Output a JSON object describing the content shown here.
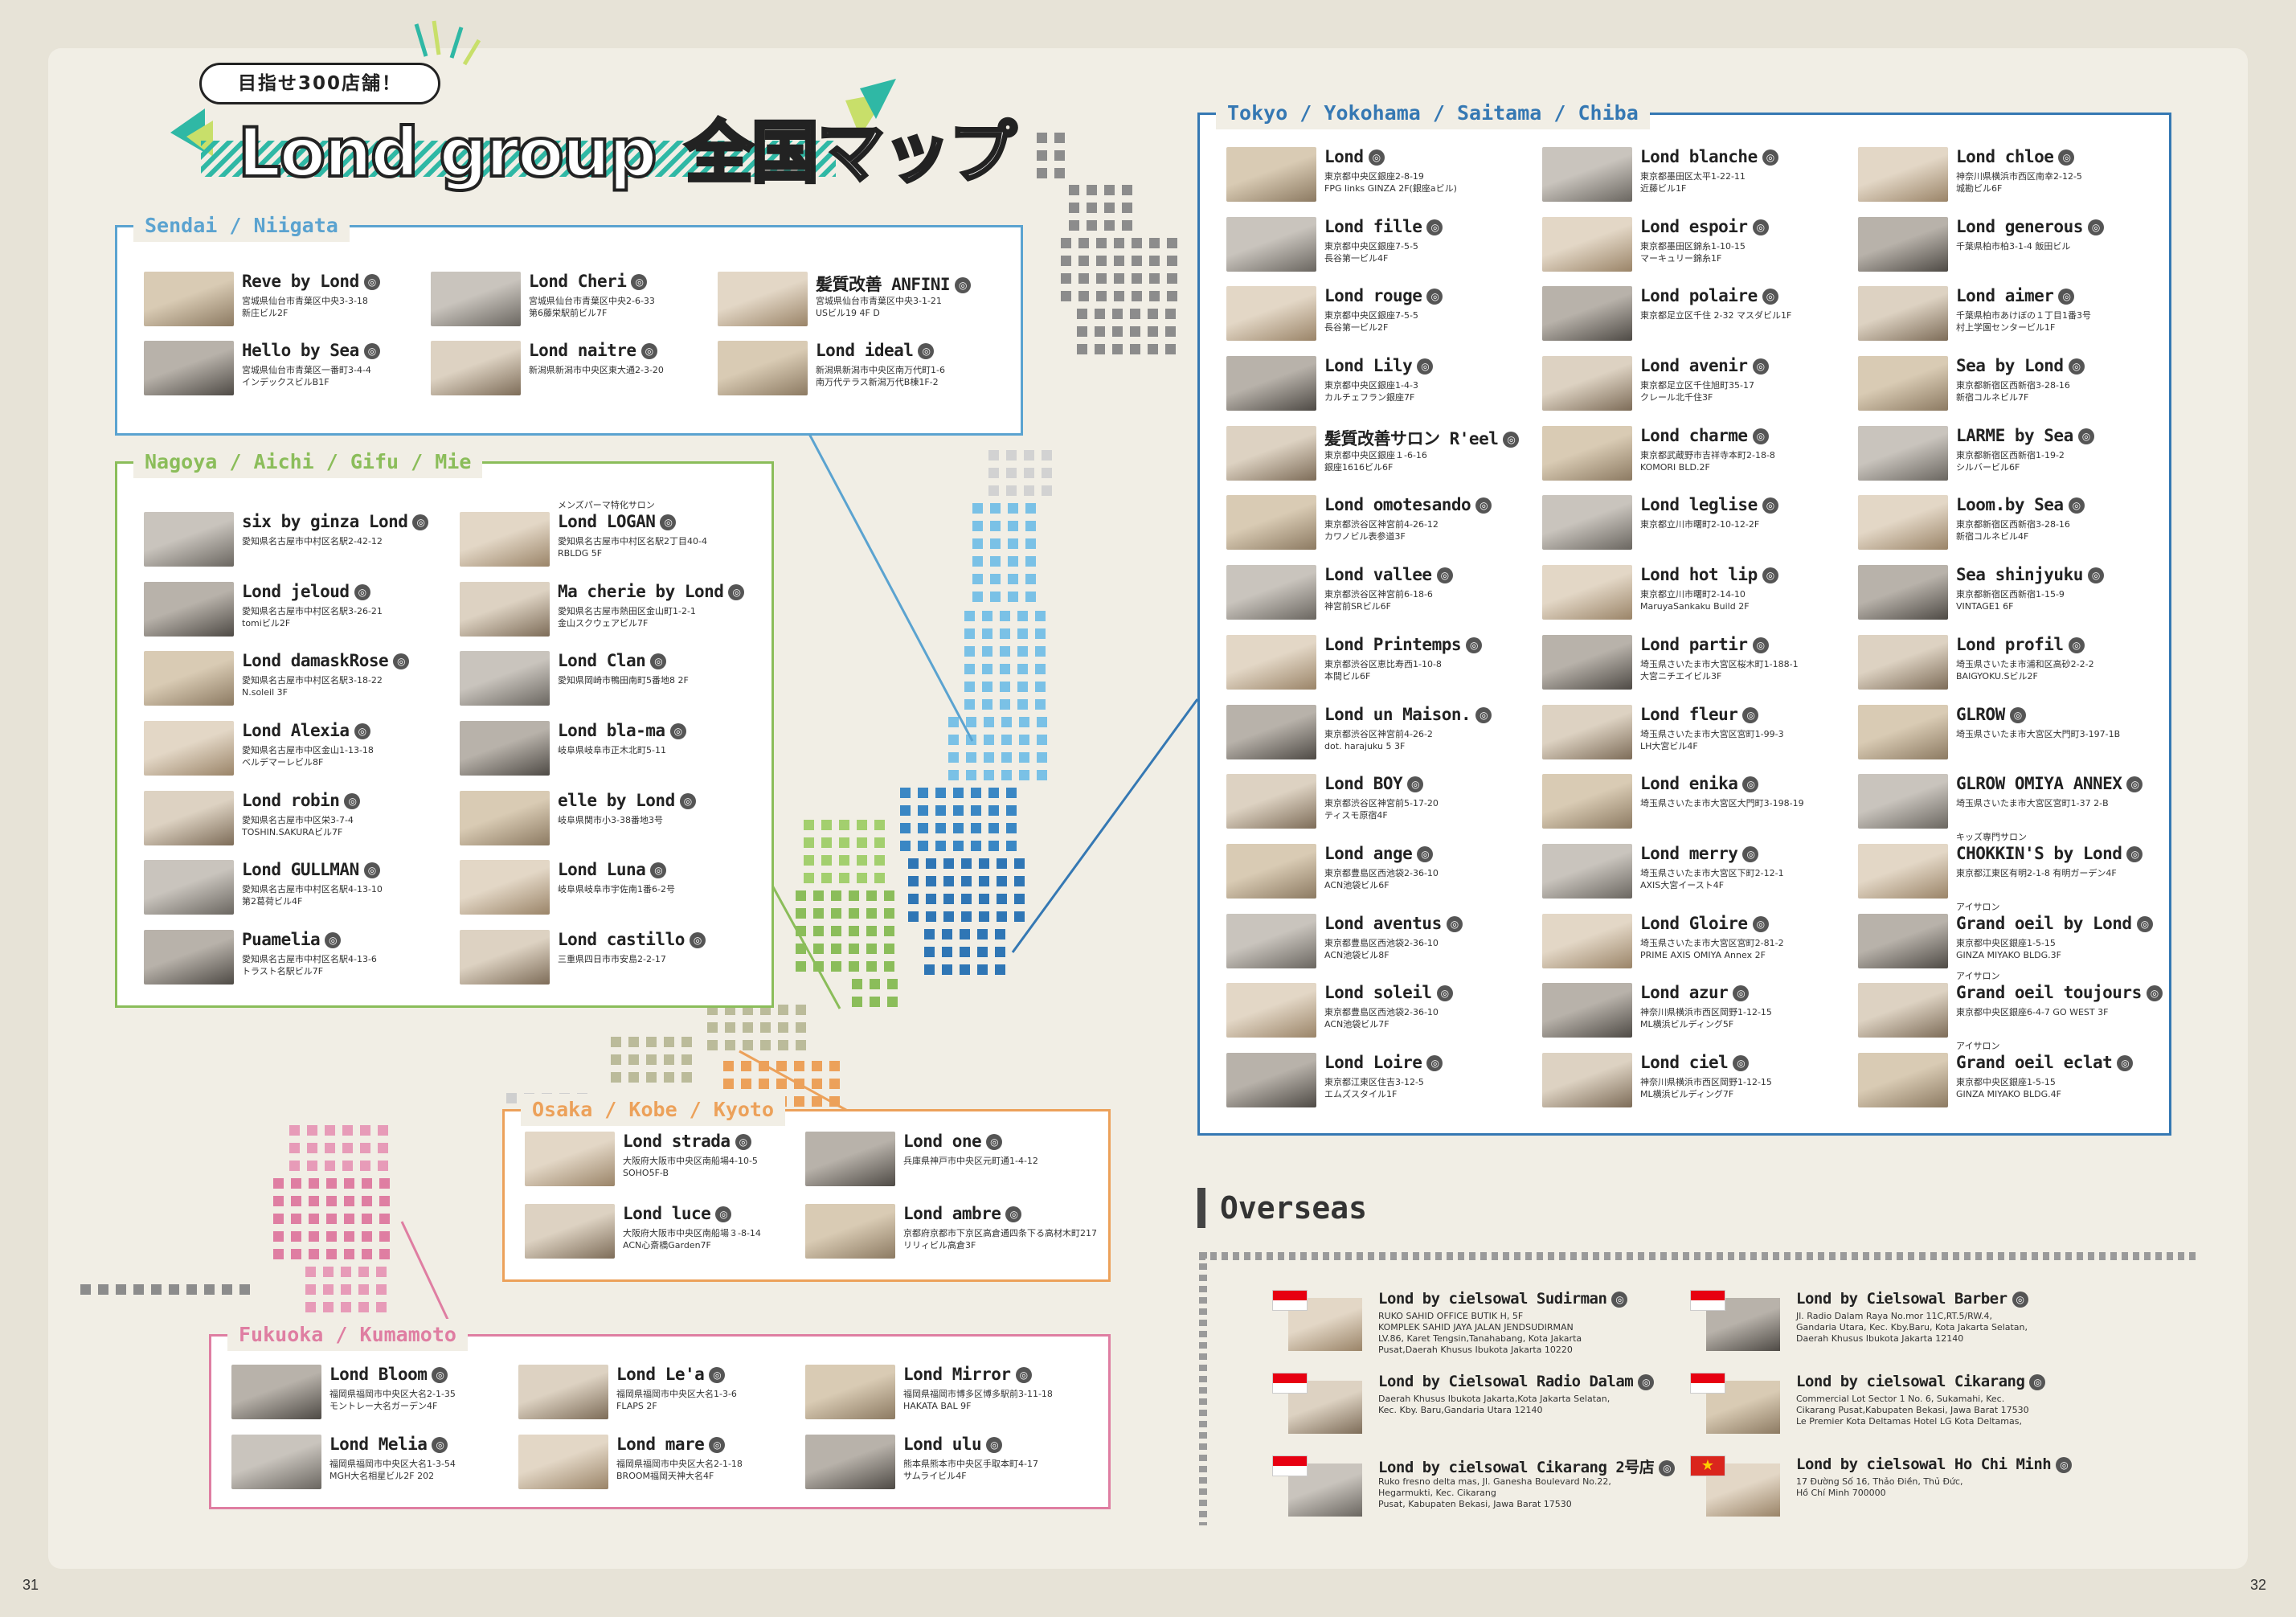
{
  "header": {
    "badge": "目指せ300店舗！",
    "title_latin": "Lond group",
    "title_jp": "全国マップ"
  },
  "pages": {
    "left": "31",
    "right": "32"
  },
  "colors": {
    "sendai": "#5ba3d0",
    "nagoya": "#8bbd5a",
    "osaka": "#eca15a",
    "fukuoka": "#df7ea2",
    "tokyo": "#3578b3",
    "accent_teal": "#2fb8a5",
    "accent_lime": "#c8df6a"
  },
  "regions": [
    {
      "title": "Sendai / Niigata",
      "stores": [
        {
          "name": "Reve by Lond",
          "address": "宮城県仙台市青葉区中央3-3-18\n新庄ビル2F"
        },
        {
          "name": "Lond Cheri",
          "address": "宮城県仙台市青葉区中央2-6-33\n第6藤栄駅前ビル7F"
        },
        {
          "name": "髪質改善 ANFINI",
          "address": "宮城県仙台市青葉区中央3-1-21\nUSビル19 4F D"
        },
        {
          "name": "Hello by Sea",
          "address": "宮城県仙台市青葉区一番町3-4-4\nインデックスビルB1F"
        },
        {
          "name": "Lond naitre",
          "address": "新潟県新潟市中央区東大通2-3-20"
        },
        {
          "name": "Lond ideal",
          "address": "新潟県新潟市中央区南万代町1-6\n南万代テラス新潟万代B棟1F-2"
        }
      ]
    },
    {
      "title": "Nagoya / Aichi / Gifu / Mie",
      "stores": [
        {
          "name": "six by ginza Lond",
          "address": "愛知県名古屋市中村区名駅2-42-12"
        },
        {
          "tag": "メンズパーマ特化サロン",
          "name": "Lond LOGAN",
          "address": "愛知県名古屋市中村区名駅2丁目40-4\nRBLDG 5F"
        },
        {
          "name": "Lond jeloud",
          "address": "愛知県名古屋市中村区名駅3-26-21\ntomiビル2F"
        },
        {
          "name": "Ma cherie by Lond",
          "address": "愛知県名古屋市熱田区金山町1-2-1\n金山スクウェアビル7F"
        },
        {
          "name": "Lond damaskRose",
          "address": "愛知県名古屋市中村区名駅3-18-22\nN.soleil 3F"
        },
        {
          "name": "Lond Clan",
          "address": "愛知県岡崎市鴨田南町5番地8 2F"
        },
        {
          "name": "Lond Alexia",
          "address": "愛知県名古屋市中区金山1-13-18\nベルデマーレビル8F"
        },
        {
          "name": "Lond bla-ma",
          "address": "岐阜県岐阜市正木北町5-11"
        },
        {
          "name": "Lond robin",
          "address": "愛知県名古屋市中区栄3-7-4\nTOSHIN.SAKURAビル7F"
        },
        {
          "name": "elle by Lond",
          "address": "岐阜県関市小3-38番地3号"
        },
        {
          "name": "Lond GULLMAN",
          "address": "愛知県名古屋市中村区名駅4-13-10\n第2葛荷ビル4F"
        },
        {
          "name": "Lond Luna",
          "address": "岐阜県岐阜市宇佐南1番6-2号"
        },
        {
          "name": "Puamelia",
          "address": "愛知県名古屋市中村区名駅4-13-6\nトラスト名駅ビル7F"
        },
        {
          "name": "Lond castillo",
          "address": "三重県四日市市安島2-2-17"
        }
      ]
    },
    {
      "title": "Osaka / Kobe / Kyoto",
      "stores": [
        {
          "name": "Lond strada",
          "address": "大阪府大阪市中央区南船場4-10-5\nSOHO5F-B"
        },
        {
          "name": "Lond one",
          "address": "兵庫県神戸市中央区元町通1-4-12"
        },
        {
          "name": "Lond luce",
          "address": "大阪府大阪市中央区南船場３-8-14\nACN心斎橋Garden7F"
        },
        {
          "name": "Lond ambre",
          "address": "京都府京都市下京区高倉通四条下る高材木町217\nリリィビル高倉3F"
        }
      ]
    },
    {
      "title": "Fukuoka / Kumamoto",
      "stores": [
        {
          "name": "Lond Bloom",
          "address": "福岡県福岡市中央区大名2-1-35\nモントレー大名ガーデン4F"
        },
        {
          "name": "Lond Le'a",
          "address": "福岡県福岡市中央区大名1-3-6\nFLAPS 2F"
        },
        {
          "name": "Lond Mirror",
          "address": "福岡県福岡市博多区博多駅前3-11-18\nHAKATA BAL 9F"
        },
        {
          "name": "Lond Melia",
          "address": "福岡県福岡市中央区大名1-3-54\nMGH大名相星ビル2F 202"
        },
        {
          "name": "Lond mare",
          "address": "福岡県福岡市中央区大名2-1-18\nBROOM福岡天神大名4F"
        },
        {
          "name": "Lond ulu",
          "address": "熊本県熊本市中央区手取本町4-17\nサムライビル4F"
        }
      ]
    },
    {
      "title": "Tokyo / Yokohama / Saitama / Chiba",
      "columns": [
        [
          {
            "name": "Lond",
            "address": "東京都中央区銀座2-8-19\nFPG links GINZA 2F(銀座aビル)"
          },
          {
            "name": "Lond fille",
            "address": "東京都中央区銀座7-5-5\n長谷第一ビル4F"
          },
          {
            "name": "Lond rouge",
            "address": "東京都中央区銀座7-5-5\n長谷第一ビル2F"
          },
          {
            "name": "Lond Lily",
            "address": "東京都中央区銀座1-4-3\nカルチェフラン銀座7F"
          },
          {
            "name": "髪質改善サロン R'eel",
            "address": "東京都中央区銀座１-6-16\n銀座1616ビル6F"
          },
          {
            "name": "Lond omotesando",
            "address": "東京都渋谷区神宮前4-26-12\nカワノビル表参道3F"
          },
          {
            "name": "Lond vallee",
            "address": "東京都渋谷区神宮前6-18-6\n神宮前SRビル6F"
          },
          {
            "name": "Lond Printemps",
            "address": "東京都渋谷区恵比寿西1-10-8\n本間ビル6F"
          },
          {
            "name": "Lond un Maison.",
            "address": "東京都渋谷区神宮前4-26-2\ndot. harajuku 5 3F"
          },
          {
            "name": "Lond BOY",
            "address": "東京都渋谷区神宮前5-17-20\nティスモ原宿4F"
          },
          {
            "name": "Lond ange",
            "address": "東京都豊島区西池袋2-36-10\nACN池袋ビル6F"
          },
          {
            "name": "Lond aventus",
            "address": "東京都豊島区西池袋2-36-10\nACN池袋ビル8F"
          },
          {
            "name": "Lond soleil",
            "address": "東京都豊島区西池袋2-36-10\nACN池袋ビル7F"
          },
          {
            "name": "Lond Loire",
            "address": "東京都江東区住吉3-12-5\nエムズスタイル1F"
          }
        ],
        [
          {
            "name": "Lond blanche",
            "address": "東京都墨田区太平1-22-11\n近藤ビル1F"
          },
          {
            "name": "Lond espoir",
            "address": "東京都墨田区錦糸1-10-15\nマーキュリー錦糸1F"
          },
          {
            "name": "Lond polaire",
            "address": "東京都足立区千住 2-32 マスダビル1F"
          },
          {
            "name": "Lond avenir",
            "address": "東京都足立区千住旭町35-17\nクレール北千住3F"
          },
          {
            "name": "Lond charme",
            "address": "東京都武蔵野市吉祥寺本町2-18-8\nKOMORI BLD.2F"
          },
          {
            "name": "Lond leglise",
            "address": "東京都立川市曙町2-10-12-2F"
          },
          {
            "name": "Lond hot lip",
            "address": "東京都立川市曙町2-14-10\nMaruyaSankaku Build 2F"
          },
          {
            "name": "Lond partir",
            "address": "埼玉県さいたま市大宮区桜木町1-188-1\n大宮ニチエイビル3F"
          },
          {
            "name": "Lond fleur",
            "address": "埼玉県さいたま市大宮区宮町1-99-3\nLH大宮ビル4F"
          },
          {
            "name": "Lond enika",
            "address": "埼玉県さいたま市大宮区大門町3-198-19"
          },
          {
            "name": "Lond merry",
            "address": "埼玉県さいたま市大宮区下町2-12-1\nAXIS大宮イースト4F"
          },
          {
            "name": "Lond Gloire",
            "address": "埼玉県さいたま市大宮区宮町2-81-2\nPRIME AXIS OMIYA Annex 2F"
          },
          {
            "name": "Lond azur",
            "address": "神奈川県横浜市西区岡野1-12-15\nML横浜ビルディング5F"
          },
          {
            "name": "Lond ciel",
            "address": "神奈川県横浜市西区岡野1-12-15\nML横浜ビルディング7F"
          }
        ],
        [
          {
            "name": "Lond chloe",
            "address": "神奈川県横浜市西区南幸2-12-5\n城勘ビル6F"
          },
          {
            "name": "Lond generous",
            "address": "千葉県柏市柏3-1-4 飯田ビル"
          },
          {
            "name": "Lond aimer",
            "address": "千葉県柏市あけぼの１丁目1番3号\n村上学園センタービル1F"
          },
          {
            "name": "Sea by Lond",
            "address": "東京都新宿区西新宿3-28-16\n新宿コルネビル7F"
          },
          {
            "name": "LARME by Sea",
            "address": "東京都新宿区西新宿1-19-2\nシルバービル6F"
          },
          {
            "name": "Loom.by Sea",
            "address": "東京都新宿区西新宿3-28-16\n新宿コルネビル4F"
          },
          {
            "name": "Sea shinjyuku",
            "address": "東京都新宿区西新宿1-15-9\nVINTAGE1 6F"
          },
          {
            "name": "Lond profil",
            "address": "埼玉県さいたま市浦和区高砂2-2-2\nBAIGYOKU.Sビル2F"
          },
          {
            "name": "GLROW",
            "address": "埼玉県さいたま市大宮区大門町3-197-1B"
          },
          {
            "name": "GLROW OMIYA ANNEX",
            "address": "埼玉県さいたま市大宮区宮町1-37 2-B"
          },
          {
            "tag": "キッズ専門サロン",
            "name": "CHOKKIN'S by Lond",
            "address": "東京都江東区有明2-1-8 有明ガーデン4F"
          },
          {
            "tag": "アイサロン",
            "name": "Grand oeil by Lond",
            "address": "東京都中央区銀座1-5-15\nGINZA MIYAKO BLDG.3F"
          },
          {
            "tag": "アイサロン",
            "name": "Grand oeil toujours",
            "address": "東京都中央区銀座6-4-7 GO WEST 3F"
          },
          {
            "tag": "アイサロン",
            "name": "Grand oeil eclat",
            "address": "東京都中央区銀座1-5-15\nGINZA MIYAKO BLDG.4F"
          }
        ]
      ]
    }
  ],
  "overseas": {
    "title": "Overseas",
    "stores": [
      {
        "flag": "indonesia",
        "name": "Lond by cielsowal Sudirman",
        "address": "RUKO SAHID OFFICE BUTIK H, 5F\nKOMPLEK SAHID JAYA JALAN JENDSUDIRMAN\nLV.86, Karet Tengsin,Tanahabang, Kota Jakarta\nPusat,Daerah Khusus Ibukota Jakarta 10220"
      },
      {
        "flag": "indonesia",
        "name": "Lond by Cielsowal Barber",
        "address": "Jl. Radio Dalam Raya No.mor 11C,RT.5/RW.4,\nGandaria Utara, Kec. Kby.Baru, Kota Jakarta Selatan,\nDaerah Khusus Ibukota Jakarta 12140"
      },
      {
        "flag": "indonesia",
        "name": "Lond by Cielsowal Radio Dalam",
        "address": "Daerah Khusus Ibukota Jakarta,Kota Jakarta Selatan,\nKec. Kby. Baru,Gandaria Utara 12140"
      },
      {
        "flag": "indonesia",
        "name": "Lond by cielsowal Cikarang",
        "address": "Commercial Lot Sector 1 No. 6, Sukamahi, Kec.\nCikarang Pusat,Kabupaten Bekasi, Jawa Barat 17530\nLe Premier Kota Deltamas Hotel LG Kota Deltamas,"
      },
      {
        "flag": "indonesia",
        "name": "Lond by cielsowal Cikarang 2号店",
        "address": "Ruko fresno delta mas, Jl. Ganesha Boulevard No.22,\nHegarmukti, Kec. Cikarang\nPusat, Kabupaten Bekasi, Jawa Barat 17530"
      },
      {
        "flag": "vietnam",
        "name": "Lond by cielsowal Ho Chi Minh",
        "address": "17 Đường Số 16, Thảo Điền, Thủ Đức,\nHồ Chí Minh 700000"
      }
    ]
  }
}
